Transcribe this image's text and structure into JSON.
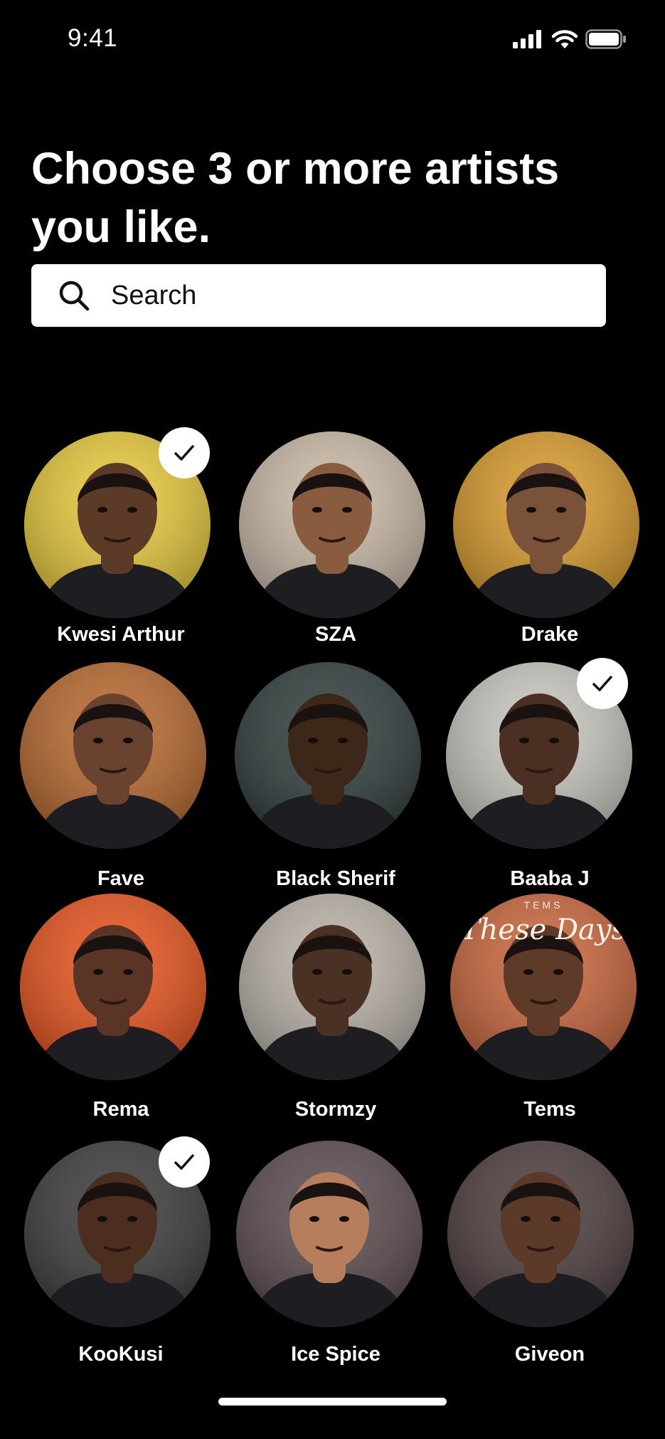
{
  "status": {
    "time": "9:41",
    "icons": [
      "cellular-signal-icon",
      "wifi-icon",
      "battery-icon"
    ]
  },
  "title": "Choose 3 or more artists you like.",
  "search": {
    "placeholder": "Search",
    "value": ""
  },
  "artists": [
    {
      "name": "Kwesi Arthur",
      "selected": true,
      "bg": "#e8c93a",
      "skin": "#5b3a28"
    },
    {
      "name": "SZA",
      "selected": false,
      "bg": "#c9b9a6",
      "skin": "#8a5c3f"
    },
    {
      "name": "Drake",
      "selected": false,
      "bg": "#d89a2a",
      "skin": "#7a5139"
    },
    {
      "name": "Fave",
      "selected": false,
      "bg": "#b8672c",
      "skin": "#6a4330"
    },
    {
      "name": "Black Sherif",
      "selected": false,
      "bg": "#2e3b3a",
      "skin": "#3d2719"
    },
    {
      "name": "Baaba J",
      "selected": true,
      "bg": "#c8c6bf",
      "skin": "#4a2f22"
    },
    {
      "name": "Rema",
      "selected": false,
      "bg": "#e8521c",
      "skin": "#5a3526"
    },
    {
      "name": "Stormzy",
      "selected": false,
      "bg": "#b9b2a8",
      "skin": "#4b3024"
    },
    {
      "name": "Tems",
      "selected": false,
      "bg": "#c9643a",
      "skin": "#5e3a28",
      "cover_title": "These Days",
      "cover_label": "TEMS"
    },
    {
      "name": "KooKusi",
      "selected": true,
      "bg": "#3a3a3a",
      "skin": "#4c2e20"
    },
    {
      "name": "Ice Spice",
      "selected": false,
      "bg": "#5a4a4e",
      "skin": "#b77e5e"
    },
    {
      "name": "Giveon",
      "selected": false,
      "bg": "#4b3b3c",
      "skin": "#5c3a2a"
    }
  ]
}
